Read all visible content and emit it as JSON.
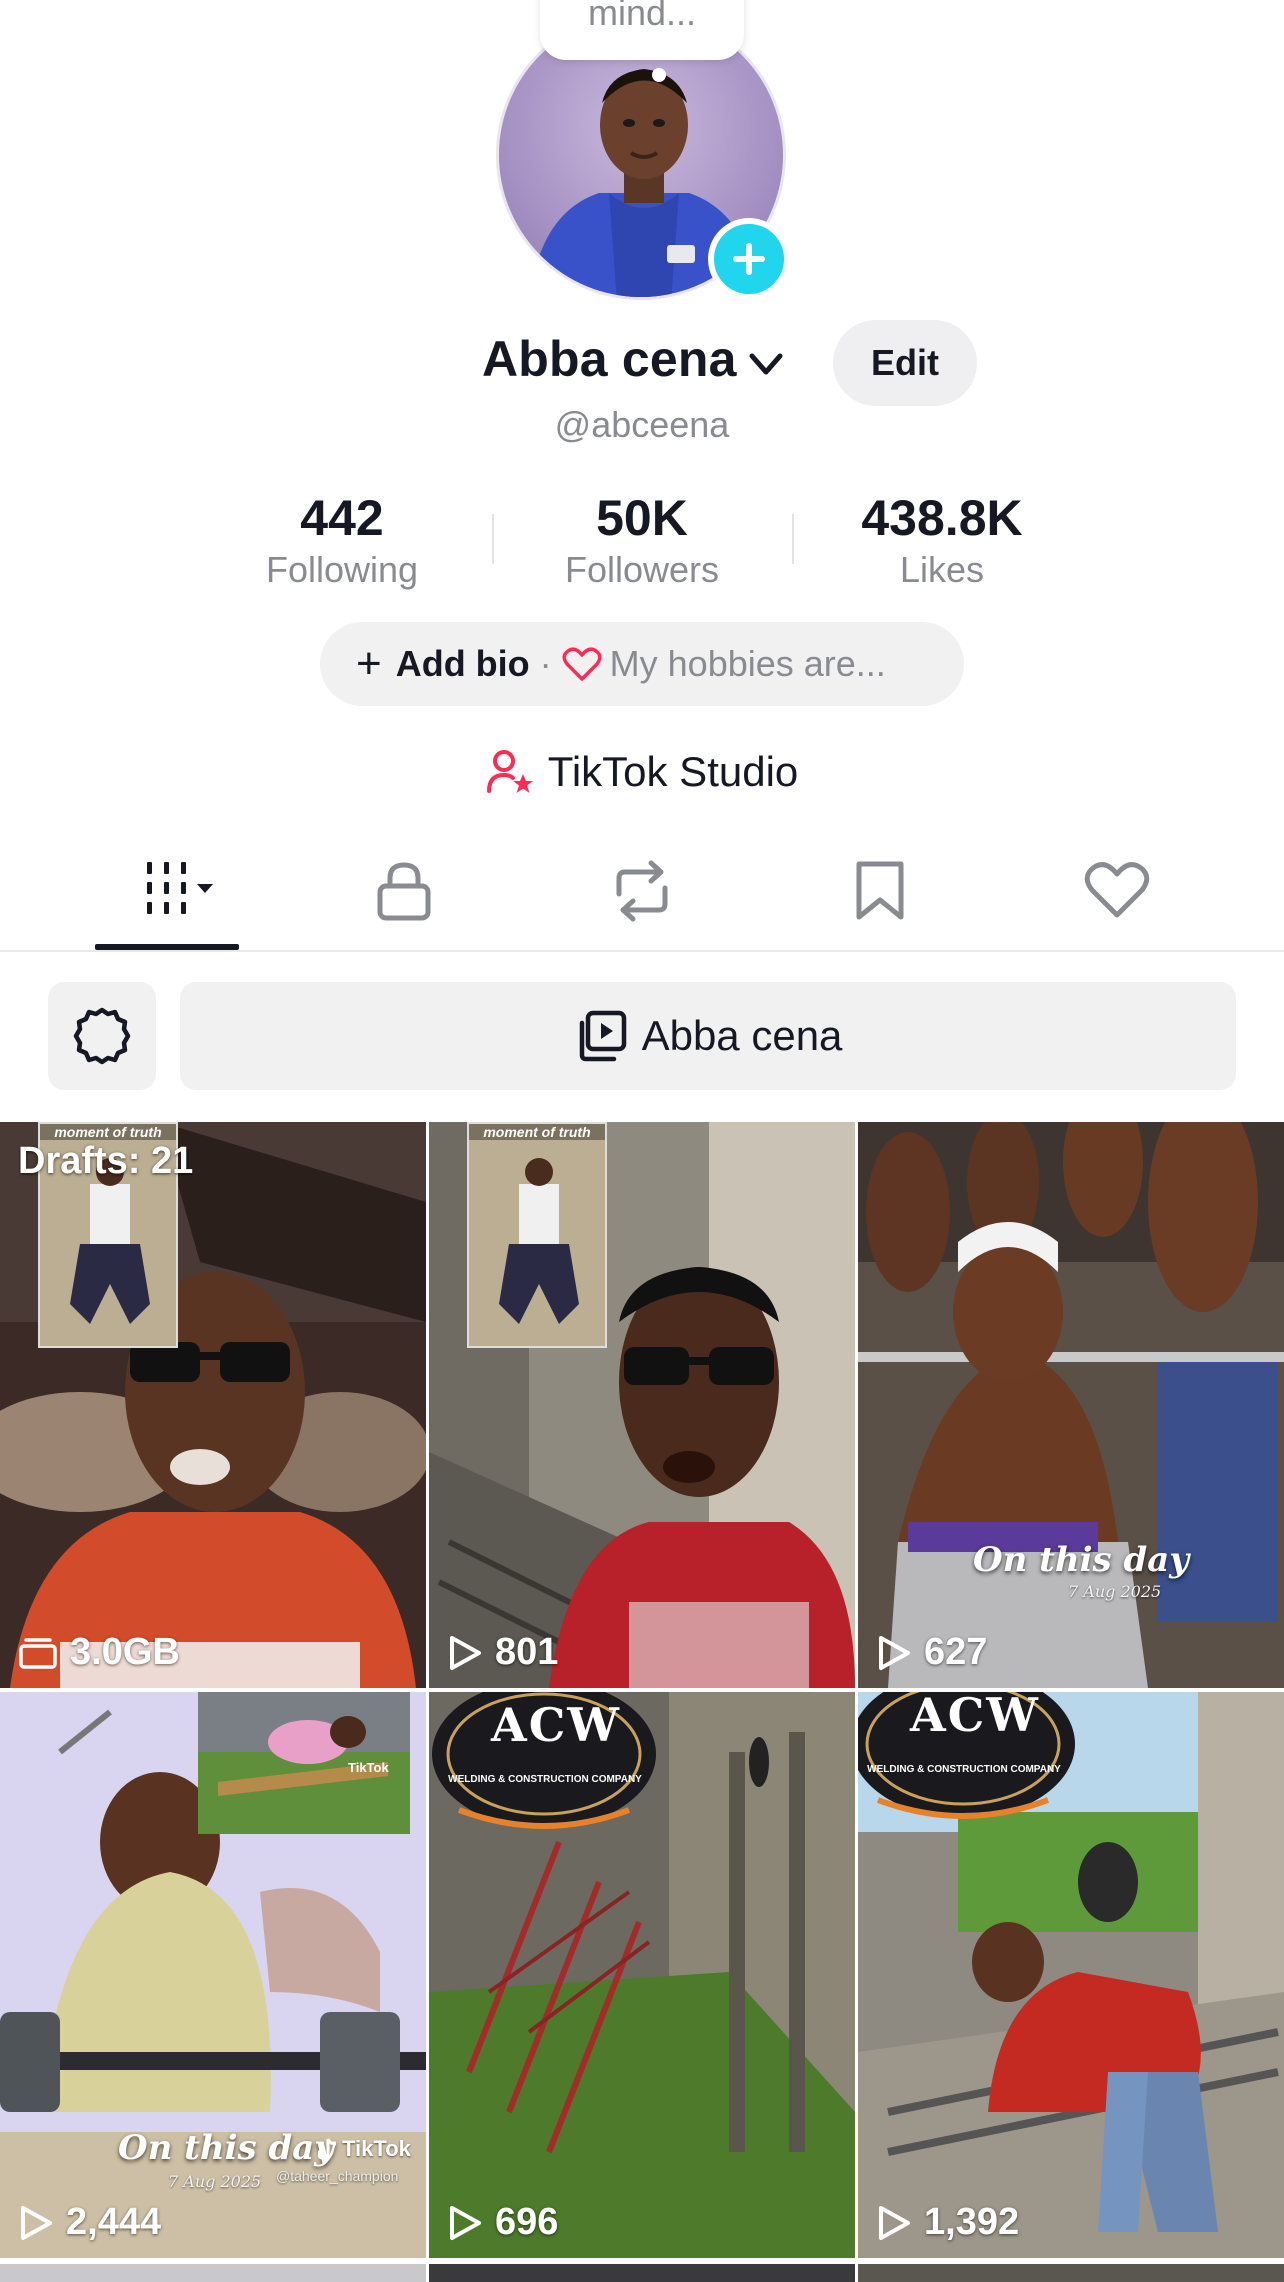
{
  "profile": {
    "thought_bubble": "mind...",
    "display_name": "Abba cena",
    "edit_label": "Edit",
    "handle": "@abceena",
    "stats": [
      {
        "value": "442",
        "label": "Following"
      },
      {
        "value": "50K",
        "label": "Followers"
      },
      {
        "value": "438.8K",
        "label": "Likes"
      }
    ],
    "bio": {
      "add_label": "Add bio",
      "separator": "·",
      "hint": "My hobbies are..."
    },
    "studio_label": "TikTok Studio"
  },
  "tabs": [
    {
      "name": "videos",
      "icon": "grid-bars-icon",
      "active": true
    },
    {
      "name": "private",
      "icon": "lock-icon",
      "active": false
    },
    {
      "name": "reposts",
      "icon": "repost-icon",
      "active": false
    },
    {
      "name": "favorites",
      "icon": "bookmark-icon",
      "active": false
    },
    {
      "name": "liked",
      "icon": "heart-icon",
      "active": false
    }
  ],
  "toolbar": {
    "playlist_label": "Abba cena"
  },
  "grid": {
    "drafts_label": "Drafts: 21",
    "tiles": [
      {
        "count": "3.0GB",
        "count_icon": "drafts-icon",
        "inset_caption": "moment of truth"
      },
      {
        "count": "801",
        "count_icon": "play-icon",
        "inset_caption": "moment of truth"
      },
      {
        "count": "627",
        "count_icon": "play-icon",
        "overlay": "On this day",
        "overlay_sub": "7 Aug 2025"
      },
      {
        "count": "2,444",
        "count_icon": "play-icon",
        "overlay": "On this day",
        "overlay_sub": "7 Aug 2025",
        "watermark": "TikTok",
        "watermark_handle": "@taheer_champion"
      },
      {
        "count": "696",
        "count_icon": "play-icon",
        "logo": "ACW",
        "logo_sub": "WELDING & CONSTRUCTION COMPANY"
      },
      {
        "count": "1,392",
        "count_icon": "play-icon",
        "logo": "ACW",
        "logo_sub": "WELDING & CONSTRUCTION COMPANY"
      }
    ]
  },
  "colors": {
    "accent_cyan": "#20d5ec",
    "accent_pink": "#fe2c55",
    "text_primary": "#161823",
    "text_secondary": "#8a8b91"
  }
}
